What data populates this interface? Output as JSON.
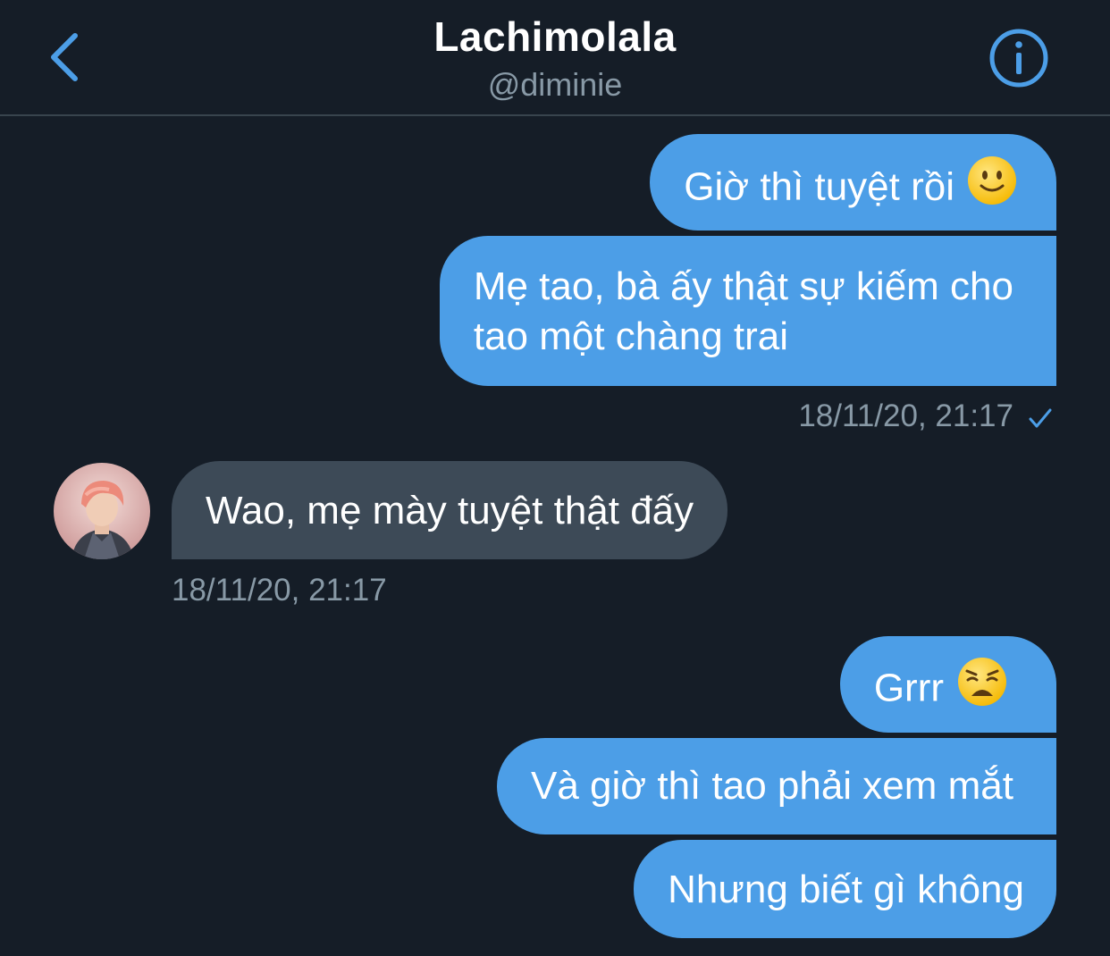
{
  "header": {
    "title": "Lachimolala",
    "handle": "@diminie",
    "back_icon": "chevron-left-icon",
    "info_icon": "info-icon"
  },
  "colors": {
    "background": "#151d27",
    "outgoing_bubble": "#4c9ee7",
    "incoming_bubble": "#3d4a57",
    "accent": "#4c9ee7",
    "muted_text": "#8899a6"
  },
  "messages": [
    {
      "direction": "outgoing",
      "text": "Giờ thì tuyệt rồi",
      "emoji": "slightly-smiling-face"
    },
    {
      "direction": "outgoing",
      "lines": [
        "Mẹ tao, bà ấy thật sự kiếm cho",
        "tao một chàng trai"
      ]
    },
    {
      "direction": "outgoing",
      "timestamp": "18/11/20, 21:17",
      "status_icon": "check-icon"
    },
    {
      "direction": "incoming",
      "text": "Wao, mẹ mày tuyệt thật đấy",
      "avatar": "contact-avatar",
      "timestamp": "18/11/20, 21:17"
    },
    {
      "direction": "outgoing",
      "text": "Grrr",
      "emoji": "weary-face"
    },
    {
      "direction": "outgoing",
      "text": "Và giờ thì tao phải xem mắt"
    },
    {
      "direction": "outgoing",
      "text": "Nhưng biết gì không"
    }
  ]
}
